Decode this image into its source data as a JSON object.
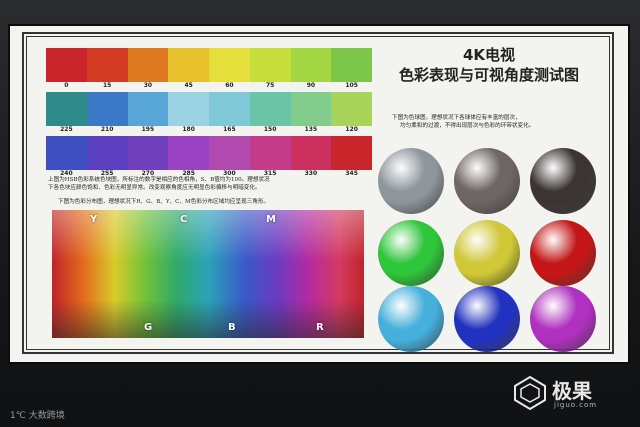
{
  "title_line1": "4K电视",
  "title_line2": "色彩表现与可视角度测试图",
  "strips": [
    {
      "colors": [
        "#c8262a",
        "#d23a22",
        "#e07a20",
        "#e8c22c",
        "#e4df3a",
        "#c6de3c",
        "#a2d642",
        "#7cc64a"
      ],
      "labels": [
        "0",
        "15",
        "30",
        "45",
        "60",
        "75",
        "90",
        "105"
      ]
    },
    {
      "colors": [
        "#2f8a8a",
        "#3a78c8",
        "#58a6d8",
        "#9ad2e4",
        "#7ec8d8",
        "#6cc4a6",
        "#82cc8c",
        "#a8d45a"
      ],
      "labels": [
        "225",
        "210",
        "195",
        "180",
        "165",
        "150",
        "135",
        "120"
      ]
    },
    {
      "colors": [
        "#3f4fc0",
        "#5a3fbe",
        "#7040bc",
        "#9a44c4",
        "#b24ab0",
        "#c43c8a",
        "#cc305e",
        "#c8262a"
      ],
      "labels": [
        "240",
        "255",
        "270",
        "285",
        "300",
        "315",
        "330",
        "345"
      ]
    }
  ],
  "desc_left_1": "上图为HSB色彩系统色块图，所标注的数字是相应的色相角，S、B值均为100。理想状况",
  "desc_left_2": "下各色块应颜色饱和、色彩无明显异常。改变观察角度应无明显色彩偏移与明暗变化。",
  "desc_left_3": "下图为色彩分布图，理想状况下R、G、B、Y、C、M色彩分布区域均应呈现三角形。",
  "spectrum_top": [
    "Y",
    "C",
    "M"
  ],
  "spectrum_bottom": [
    "G",
    "B",
    "R"
  ],
  "desc_right_1": "下图为色球图，理想状况下各球体应有丰富的层次，",
  "desc_right_2": "均匀柔和的过渡，不得出现层次与色彩的环带状变化。",
  "balls": [
    {
      "color": "#8e969c",
      "name": "gray-ball"
    },
    {
      "color": "#6e6564",
      "name": "brown-gray-ball"
    },
    {
      "color": "#3c3434",
      "name": "dark-ball"
    },
    {
      "color": "#2ec63a",
      "name": "green-ball"
    },
    {
      "color": "#d0c836",
      "name": "yellow-ball"
    },
    {
      "color": "#c41616",
      "name": "red-ball"
    },
    {
      "color": "#46b0dc",
      "name": "cyan-ball"
    },
    {
      "color": "#2232c0",
      "name": "blue-ball"
    },
    {
      "color": "#b030c0",
      "name": "magenta-ball"
    }
  ],
  "logo_text": "极果",
  "logo_sub": "jiguo.com",
  "watermark": "1℃ 大数跨境"
}
